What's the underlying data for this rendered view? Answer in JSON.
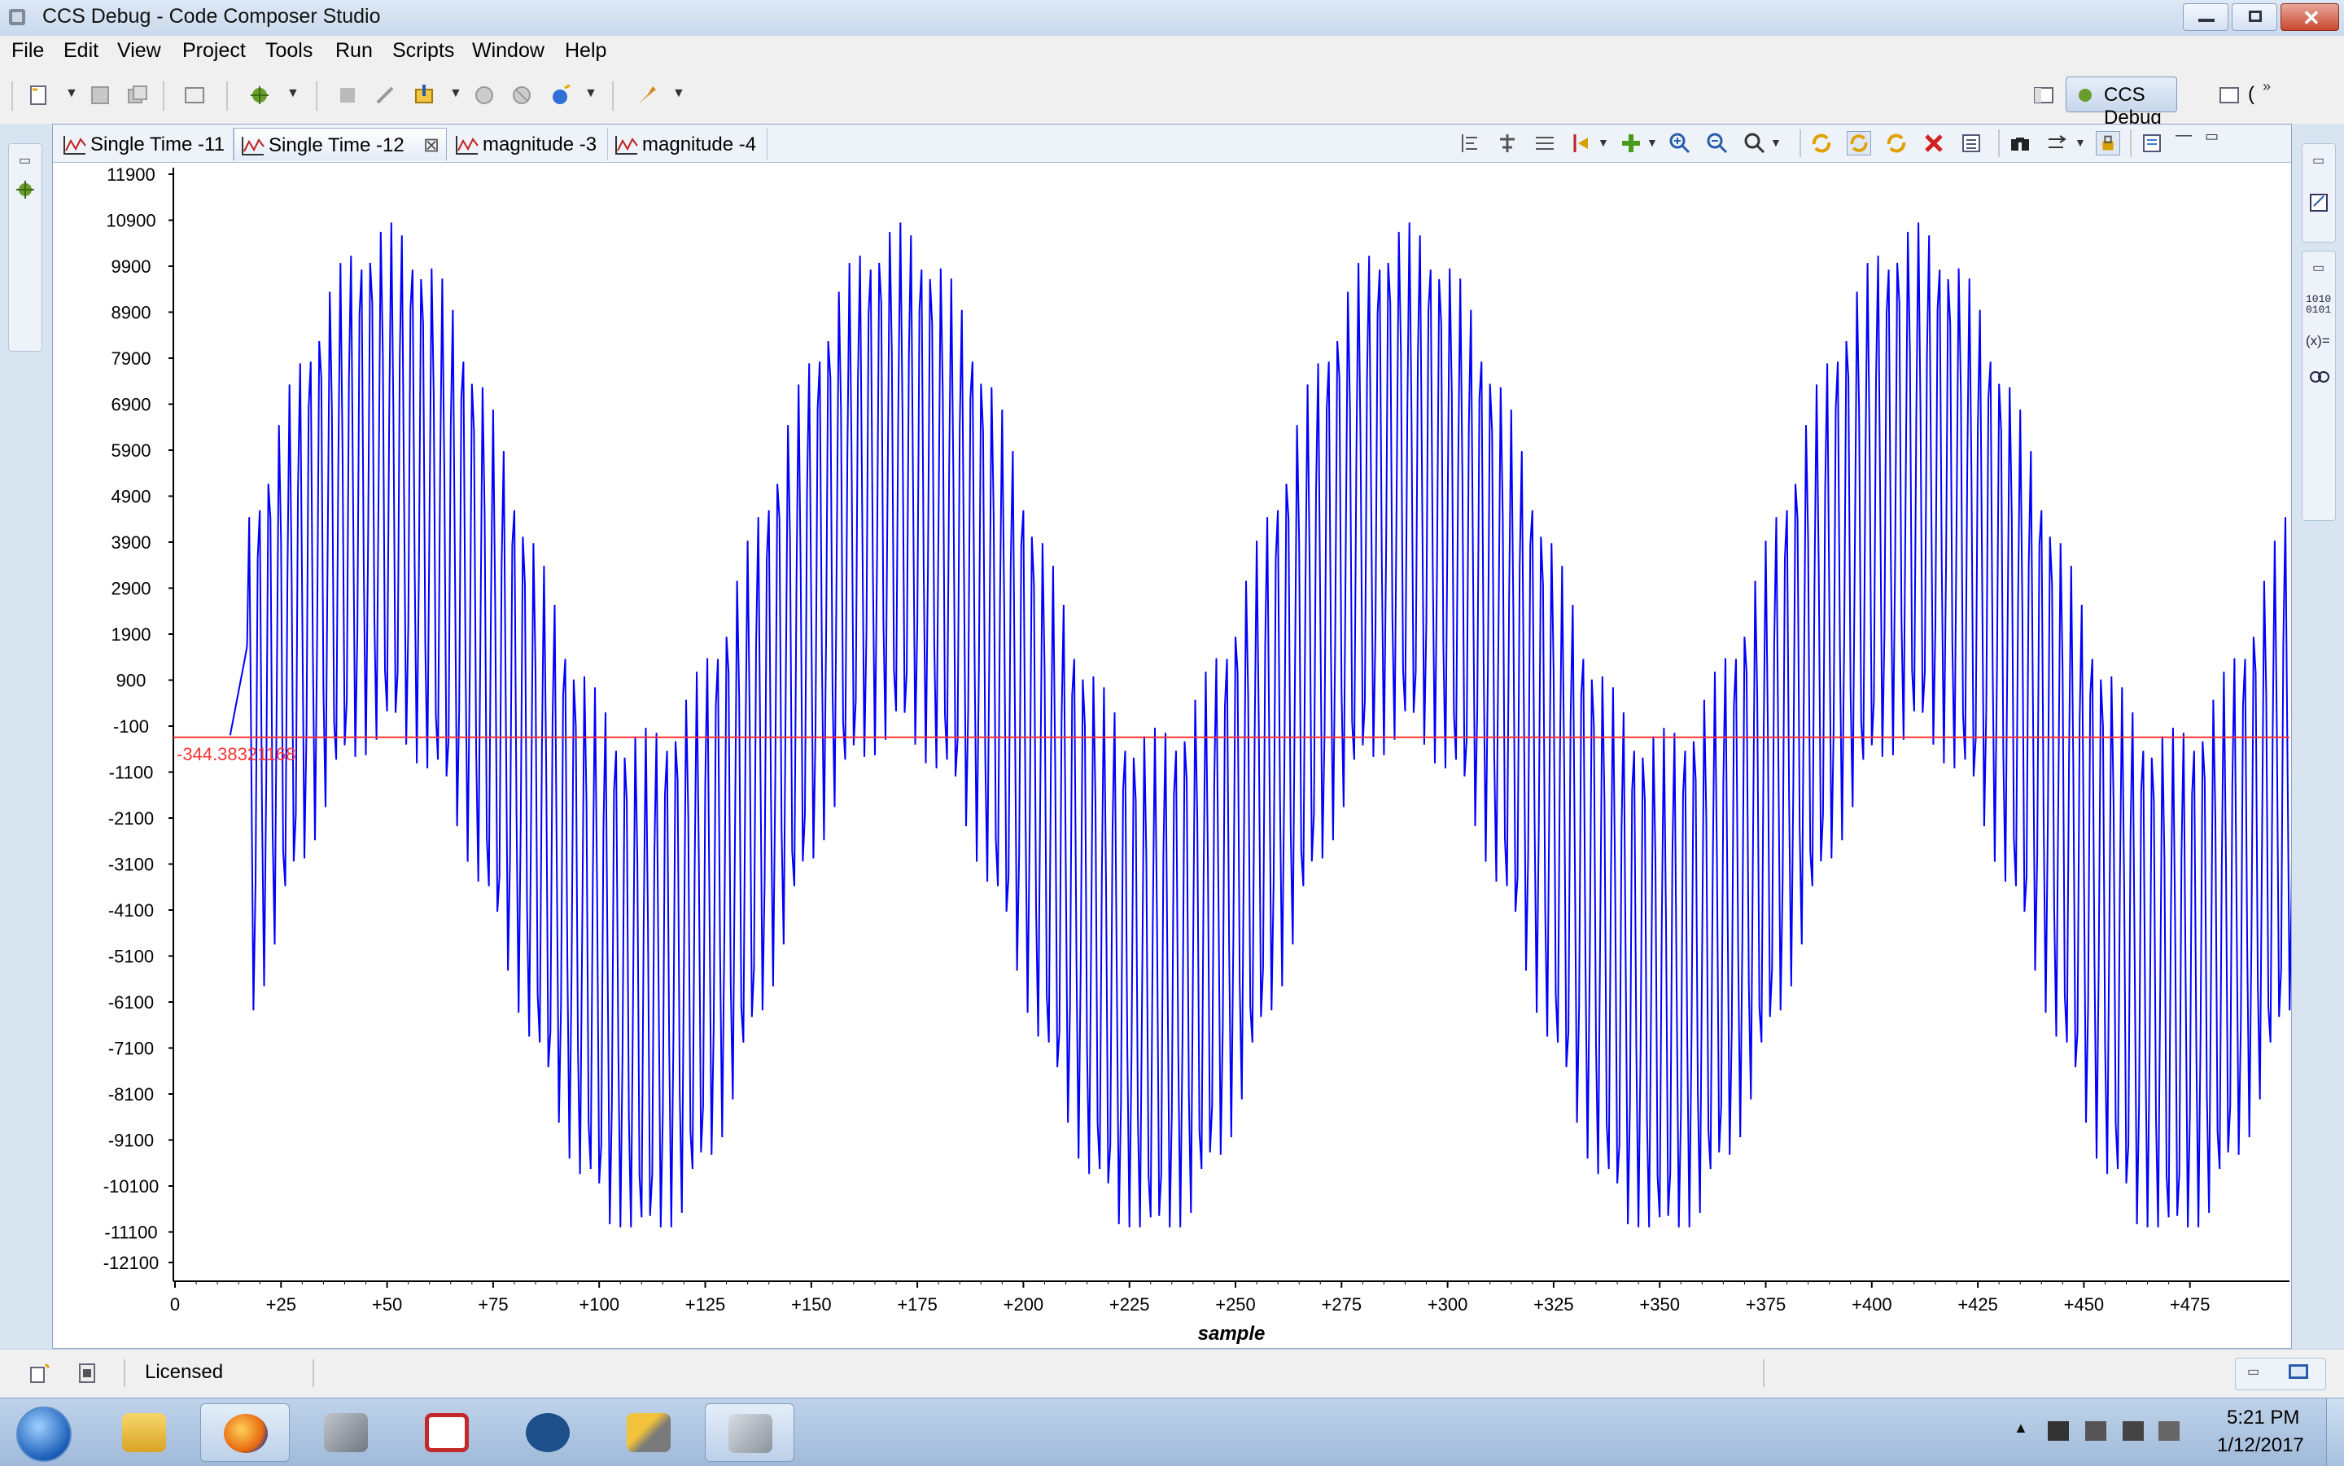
{
  "window": {
    "title": "CCS Debug - Code Composer Studio"
  },
  "menu": [
    "File",
    "Edit",
    "View",
    "Project",
    "Tools",
    "Run",
    "Scripts",
    "Window",
    "Help"
  ],
  "perspective": {
    "label": "CCS Debug",
    "overflow_label": "("
  },
  "tabs": [
    {
      "label": "Single Time -11",
      "active": false
    },
    {
      "label": "Single Time -12",
      "active": true,
      "close": "⊠"
    },
    {
      "label": "magnitude -3",
      "active": false
    },
    {
      "label": "magnitude -4",
      "active": false
    }
  ],
  "chart_data": {
    "type": "line",
    "xlabel": "sample",
    "ylabel": "",
    "x_ticks": [
      "0",
      "+25",
      "+50",
      "+75",
      "+100",
      "+125",
      "+150",
      "+175",
      "+200",
      "+225",
      "+250",
      "+275",
      "+300",
      "+325",
      "+350",
      "+375",
      "+400",
      "+425",
      "+450",
      "+475"
    ],
    "y_ticks": [
      "11900",
      "10900",
      "9900",
      "8900",
      "7900",
      "6900",
      "5900",
      "4900",
      "3900",
      "2900",
      "1900",
      "900",
      "-100",
      "-1100",
      "-2100",
      "-3100",
      "-4100",
      "-5100",
      "-6100",
      "-7100",
      "-8100",
      "-9100",
      "-10100",
      "-11100",
      "-12100"
    ],
    "xlim": [
      0,
      500
    ],
    "ylim": [
      -12100,
      11900
    ],
    "series": [
      {
        "color": "#0000ff",
        "description": "Amplitude-modulated oscillation: carrier alternating every sample with envelope period ~120 samples; envelope peaks near +11000 at samples ~50, 170, 290, 410 and troughs near -10800 at ~110, 230, 350, 470; signal begins at sample ~13",
        "start_sample": 13,
        "envelope_period": 120,
        "carrier_period_samples": 4,
        "mean": -344,
        "envelope_amplitude_max": 5500,
        "carrier_amplitude": 5700
      }
    ],
    "reference_line": {
      "value": -344.38321168,
      "label": "-344.38321168",
      "color": "#ff3333"
    },
    "grid": false
  },
  "status": {
    "text": "Licensed"
  },
  "taskbar": {
    "time": "5:21 PM",
    "date": "1/12/2017"
  }
}
